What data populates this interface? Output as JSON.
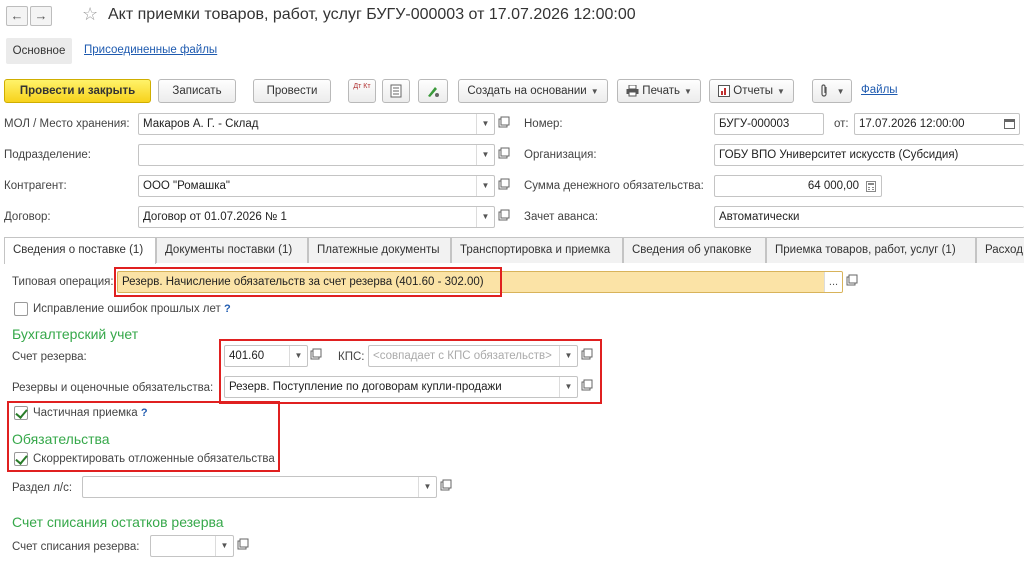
{
  "window": {
    "title": "Акт приемки товаров, работ, услуг БУГУ-000003 от 17.07.2026 12:00:00",
    "back_icon": "←",
    "forward_icon": "→",
    "favorite_icon": "☆"
  },
  "subnav": {
    "main_label": "Основное",
    "attached_files_label": "Присоединенные файлы"
  },
  "toolbar": {
    "post_close_label": "Провести и закрыть",
    "save_label": "Записать",
    "post_label": "Провести",
    "create_based_label": "Создать на основании",
    "print_label": "Печать",
    "reports_label": "Отчеты",
    "files_label": "Файлы",
    "dt_kt_label": "Дт Кт"
  },
  "header": {
    "mol_label": "МОЛ / Место хранения:",
    "mol_value": "Макаров А. Г. - Склад",
    "division_label": "Подразделение:",
    "division_value": "",
    "counterparty_label": "Контрагент:",
    "counterparty_value": "ООО \"Ромашка\"",
    "contract_label": "Договор:",
    "contract_value": "Договор от 01.07.2026 № 1",
    "number_label": "Номер:",
    "number_value": "БУГУ-000003",
    "from_label": "от:",
    "date_value": "17.07.2026 12:00:00",
    "organization_label": "Организация:",
    "organization_value": "ГОБУ ВПО Университет искусств (Субсидия)",
    "obligation_sum_label": "Сумма денежного обязательства:",
    "obligation_sum_value": "64 000,00",
    "advance_offset_label": "Зачет аванса:",
    "advance_offset_value": "Автоматически"
  },
  "tabs": [
    {
      "label": "Сведения о поставке (1)"
    },
    {
      "label": "Документы поставки (1)"
    },
    {
      "label": "Платежные документы"
    },
    {
      "label": "Транспортировка и приемка"
    },
    {
      "label": "Сведения об упаковке"
    },
    {
      "label": "Приемка товаров, работ, услуг (1)"
    },
    {
      "label": "Расход"
    }
  ],
  "content": {
    "typical_operation_label": "Типовая операция:",
    "typical_operation_value": "Резерв. Начисление обязательств за счет резерва (401.60 - 302.00)",
    "fix_errors_label": "Исправление ошибок прошлых лет",
    "fix_errors_checked": false,
    "help_mark": "?",
    "accounting_section": "Бухгалтерский учет",
    "reserve_account_label": "Счет резерва:",
    "reserve_account_value": "401.60",
    "kps_label": "КПС:",
    "kps_placeholder": "<совпадает с КПС обязательств>",
    "reserves_label": "Резервы и оценочные обязательства:",
    "reserves_value": "Резерв. Поступление по договорам купли-продажи",
    "partial_acceptance_label": "Частичная приемка",
    "partial_acceptance_checked": true,
    "obligations_section": "Обязательства",
    "adjust_deferred_label": "Скорректировать отложенные обязательства",
    "adjust_deferred_checked": true,
    "ls_section_label": "Раздел л/с:",
    "ls_section_value": "",
    "writeoff_section": "Счет списания остатков резерва",
    "writeoff_account_label": "Счет списания резерва:",
    "writeoff_account_value": ""
  },
  "colors": {
    "primary_button": "#f7d21c",
    "highlight_field": "#fbe3a6",
    "section_title": "#36a84a",
    "annotation_box": "#e02020",
    "link": "#1f5bb0"
  }
}
